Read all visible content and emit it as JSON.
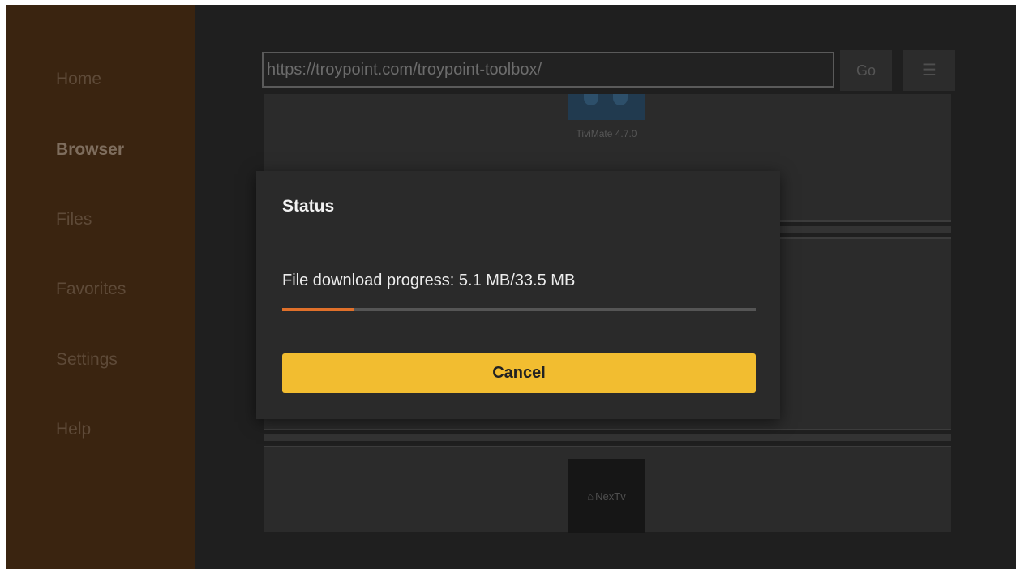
{
  "sidebar": {
    "items": [
      {
        "label": "Home"
      },
      {
        "label": "Browser"
      },
      {
        "label": "Files"
      },
      {
        "label": "Favorites"
      },
      {
        "label": "Settings"
      },
      {
        "label": "Help"
      }
    ],
    "active": "Browser"
  },
  "browser": {
    "url": "https://troypoint.com/troypoint-toolbox/",
    "go_label": "Go",
    "menu_icon": "hamburger-menu-icon",
    "items": [
      {
        "caption": "TiviMate 4.7.0"
      },
      {
        "logo_text": "NexTv"
      }
    ]
  },
  "dialog": {
    "title": "Status",
    "progress_text": "File download progress: 5.1 MB/33.5 MB",
    "progress_fraction": 0.152,
    "cancel_label": "Cancel"
  },
  "colors": {
    "sidebar_bg": "#3a2410",
    "accent_button": "#f2bd30",
    "progress": "#e0702a"
  }
}
